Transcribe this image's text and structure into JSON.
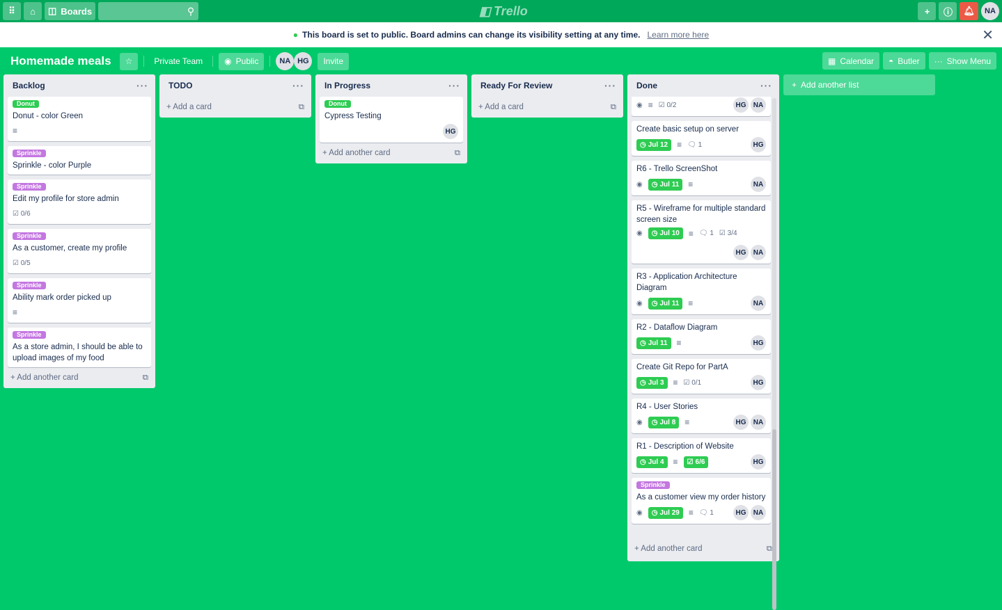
{
  "topbar": {
    "boards": "Boards",
    "logo": "Trello",
    "user": "NA"
  },
  "banner": {
    "text": "This board is set to public. Board admins can change its visibility setting at any time.",
    "link": "Learn more here"
  },
  "header": {
    "title": "Homemade meals",
    "team": "Private Team",
    "visibility": "Public",
    "members": [
      "NA",
      "HG"
    ],
    "invite": "Invite",
    "calendar": "Calendar",
    "butler": "Butler",
    "menu": "Show Menu"
  },
  "colors": {
    "green_label": "#61bd4f",
    "purple_label": "#c377e0",
    "background": "#00c96b"
  },
  "add_list": "Add another list",
  "lists": [
    {
      "name": "Backlog",
      "add": "Add another card",
      "cards": [
        {
          "label": "Donut",
          "labelColor": "#2ecc52",
          "title": "Donut - color Green",
          "desc": true
        },
        {
          "label": "Sprinkle",
          "labelColor": "#c377e0",
          "title": "Sprinkle - color Purple"
        },
        {
          "label": "Sprinkle",
          "labelColor": "#c377e0",
          "title": "Edit my profile for store admin",
          "checklist": "0/6"
        },
        {
          "label": "Sprinkle",
          "labelColor": "#c377e0",
          "title": "As a customer, create my profile",
          "checklist": "0/5"
        },
        {
          "label": "Sprinkle",
          "labelColor": "#c377e0",
          "title": "Ability mark order picked up",
          "desc": true
        },
        {
          "label": "Sprinkle",
          "labelColor": "#c377e0",
          "title": "As a store admin, I should be able to upload images of my food"
        }
      ]
    },
    {
      "name": "TODO",
      "add": "Add a card",
      "cards": []
    },
    {
      "name": "In Progress",
      "add": "Add another card",
      "cards": [
        {
          "label": "Donut",
          "labelColor": "#2ecc52",
          "title": "Cypress Testing",
          "members": [
            "HG"
          ]
        }
      ]
    },
    {
      "name": "Ready For Review",
      "add": "Add a card",
      "cards": []
    },
    {
      "name": "Done",
      "add": "Add another card",
      "cards": [
        {
          "watch": true,
          "desc": true,
          "checklist": "0/2",
          "members": [
            "HG",
            "NA"
          ],
          "partial": true
        },
        {
          "title": "Create basic setup on server",
          "due": "Jul 12",
          "desc": true,
          "comments": "1",
          "members": [
            "HG"
          ]
        },
        {
          "title": "R6 - Trello ScreenShot",
          "watch": true,
          "due": "Jul 11",
          "desc": true,
          "members": [
            "NA"
          ]
        },
        {
          "title": "R5 - Wireframe for multiple standard screen size",
          "watch": true,
          "due": "Jul 10",
          "desc": true,
          "comments": "1",
          "checklist": "3/4",
          "members": [
            "HG",
            "NA"
          ]
        },
        {
          "title": "R3 - Application Architecture Diagram",
          "watch": true,
          "due": "Jul 11",
          "desc": true,
          "members": [
            "NA"
          ]
        },
        {
          "title": "R2 - Dataflow Diagram",
          "due": "Jul 11",
          "desc": true,
          "members": [
            "HG"
          ]
        },
        {
          "title": "Create Git Repo for PartA",
          "due": "Jul 3",
          "desc": true,
          "checklist": "0/1",
          "members": [
            "HG"
          ]
        },
        {
          "title": "R4 - User Stories",
          "watch": true,
          "due": "Jul 8",
          "desc": true,
          "members": [
            "HG",
            "NA"
          ]
        },
        {
          "title": "R1 - Description of Website",
          "due": "Jul 4",
          "desc": true,
          "checklistDone": "6/6",
          "members": [
            "HG"
          ]
        },
        {
          "label": "Sprinkle",
          "labelColor": "#c377e0",
          "title": "As a customer view my order history",
          "watch": true,
          "due": "Jul 29",
          "desc": true,
          "comments": "1",
          "members": [
            "HG",
            "NA"
          ]
        }
      ]
    }
  ]
}
